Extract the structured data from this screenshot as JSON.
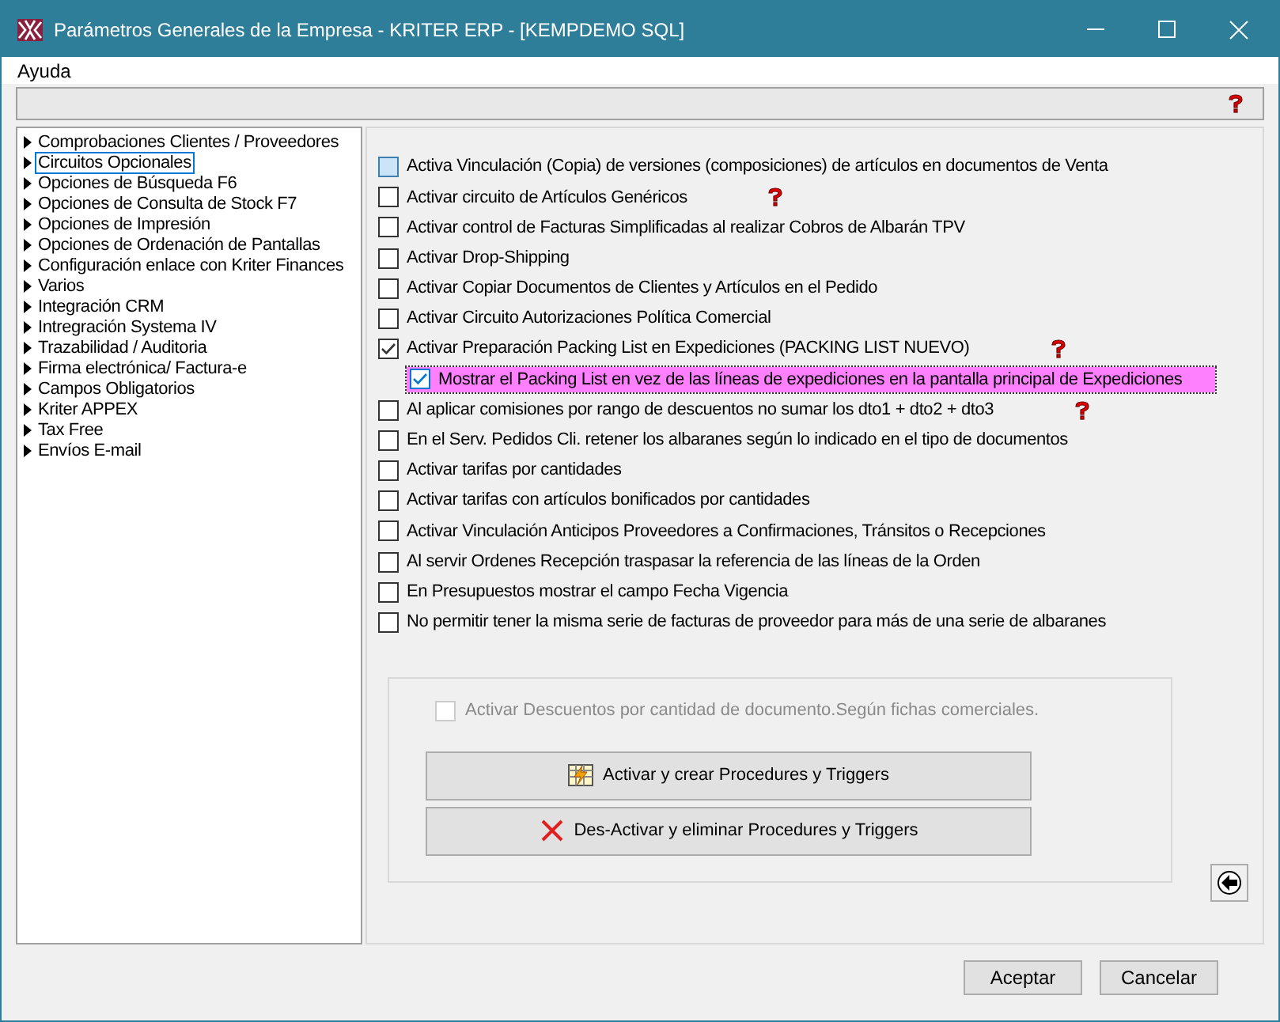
{
  "window": {
    "title": "Parámetros Generales de la Empresa - KRITER ERP - [KEMPDEMO SQL]"
  },
  "menu": [
    "Ayuda"
  ],
  "tree": [
    {
      "label": "Comprobaciones Clientes / Proveedores",
      "selected": false
    },
    {
      "label": "Circuitos Opcionales",
      "selected": true
    },
    {
      "label": "Opciones de Búsqueda F6",
      "selected": false
    },
    {
      "label": "Opciones de Consulta de Stock F7",
      "selected": false
    },
    {
      "label": "Opciones de Impresión",
      "selected": false
    },
    {
      "label": "Opciones de Ordenación de Pantallas",
      "selected": false
    },
    {
      "label": "Configuración enlace con Kriter Finances",
      "selected": false
    },
    {
      "label": "Varios",
      "selected": false
    },
    {
      "label": "Integración CRM",
      "selected": false
    },
    {
      "label": "Intregración Systema IV",
      "selected": false
    },
    {
      "label": "Trazabilidad / Auditoria",
      "selected": false
    },
    {
      "label": "Firma electrónica/ Factura-e",
      "selected": false
    },
    {
      "label": "Campos Obligatorios",
      "selected": false
    },
    {
      "label": "Kriter APPEX",
      "selected": false
    },
    {
      "label": "Tax Free",
      "selected": false
    },
    {
      "label": "Envíos E-mail",
      "selected": false
    }
  ],
  "options": [
    {
      "label": "Activa Vinculación (Copia) de versiones (composiciones) de artículos en documentos de Venta",
      "checked": false,
      "hover": true,
      "help": false,
      "highlighted": false
    },
    {
      "label": "Activar circuito de Artículos Genéricos",
      "checked": false,
      "hover": false,
      "help": true,
      "highlighted": false
    },
    {
      "label": "Activar control de Facturas Simplificadas al realizar Cobros de Albarán TPV",
      "checked": false,
      "hover": false,
      "help": false,
      "highlighted": false
    },
    {
      "label": "Activar Drop-Shipping",
      "checked": false,
      "hover": false,
      "help": false,
      "highlighted": false
    },
    {
      "label": "Activar Copiar Documentos de Clientes y Artículos en el Pedido",
      "checked": false,
      "hover": false,
      "help": false,
      "highlighted": false
    },
    {
      "label": "Activar Circuito Autorizaciones Política Comercial",
      "checked": false,
      "hover": false,
      "help": false,
      "highlighted": false
    },
    {
      "label": "Activar Preparación Packing List en Expediciones (PACKING LIST NUEVO)",
      "checked": true,
      "hover": false,
      "help": true,
      "highlighted": false,
      "children": [
        {
          "label": "Mostrar el Packing List en vez de las líneas de expediciones en la pantalla principal de Expediciones",
          "checked": true,
          "hover": false,
          "help": false,
          "highlighted": true
        }
      ]
    },
    {
      "label": "Al aplicar comisiones por rango de descuentos no sumar los dto1 + dto2 + dto3",
      "checked": false,
      "hover": false,
      "help": true,
      "highlighted": false
    },
    {
      "label": "En el Serv. Pedidos Cli. retener los albaranes según lo indicado en el tipo de documentos",
      "checked": false,
      "hover": false,
      "help": false,
      "highlighted": false
    },
    {
      "label": "Activar tarifas por cantidades",
      "checked": false,
      "hover": false,
      "help": false,
      "highlighted": false
    },
    {
      "label": "Activar tarifas con artículos bonificados por cantidades",
      "checked": false,
      "hover": false,
      "help": false,
      "highlighted": false
    },
    {
      "label": "Activar Vinculación Anticipos Proveedores a Confirmaciones, Tránsitos o Recepciones",
      "checked": false,
      "hover": false,
      "help": false,
      "highlighted": false
    },
    {
      "label": "Al servir Ordenes Recepción traspasar la referencia de las líneas de la Orden",
      "checked": false,
      "hover": false,
      "help": false,
      "highlighted": false
    },
    {
      "label": "En Presupuestos mostrar el campo Fecha Vigencia",
      "checked": false,
      "hover": false,
      "help": false,
      "highlighted": false
    },
    {
      "label": "No permitir tener la misma serie de facturas de proveedor para más de una serie de albaranes",
      "checked": false,
      "hover": false,
      "help": false,
      "highlighted": false
    }
  ],
  "discounts": {
    "label": "Activar Descuentos por cantidad de documento.Según fichas comerciales.",
    "checked": false,
    "disabled": true
  },
  "actions": [
    {
      "label": "Activar y crear Procedures y Triggers",
      "kind": "create"
    },
    {
      "label": "Des-Activar y eliminar Procedures y Triggers",
      "kind": "delete"
    }
  ],
  "buttons": [
    "Aceptar",
    "Cancelar"
  ]
}
